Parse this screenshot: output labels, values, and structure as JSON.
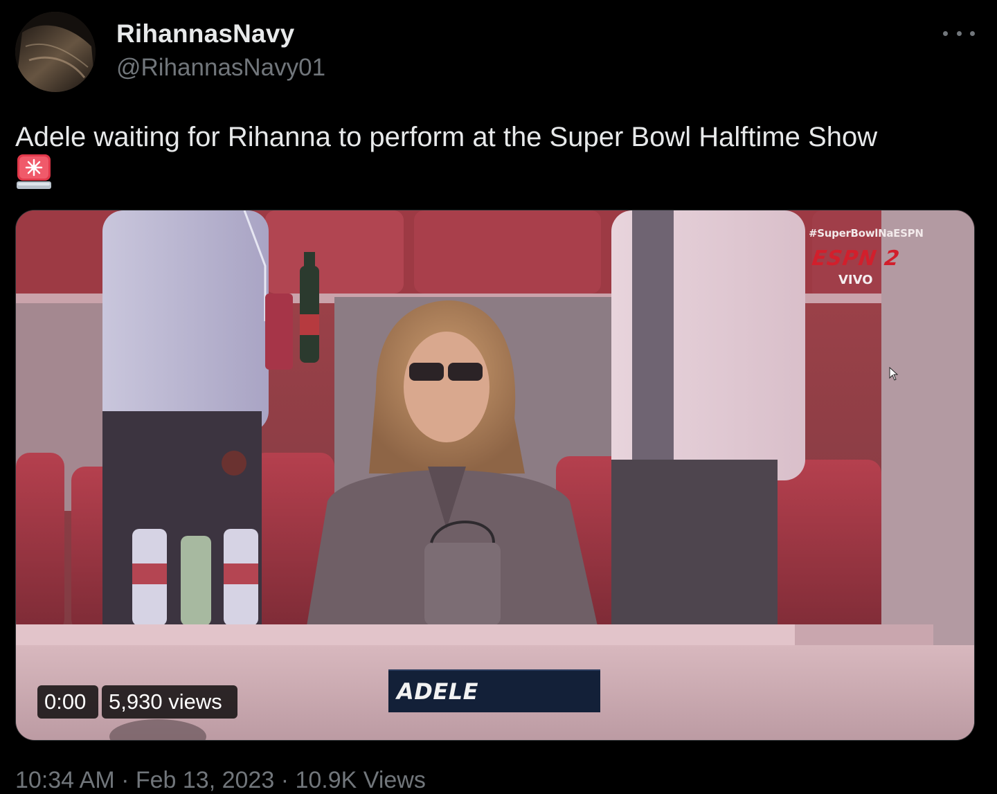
{
  "author": {
    "display_name": "RihannasNavy",
    "handle": "@RihannasNavy01"
  },
  "tweet": {
    "text": "Adele waiting for Rihanna to perform at the Super Bowl Halftime Show",
    "emoji": "🚨"
  },
  "media": {
    "hashtag_overlay": "#SuperBowlNaESPN",
    "network_logo": "ESPN 2",
    "live_label": "VIVO",
    "name_card": "ADELE",
    "timestamp": "0:00",
    "views": "5,930 views"
  },
  "footer": {
    "meta": "10:34 AM · Feb 13, 2023 · 10.9K Views"
  },
  "icons": [
    "more-icon",
    "siren-emoji-icon",
    "cursor-icon"
  ],
  "colors": {
    "background": "#000000",
    "primary_text": "#e7e9ea",
    "secondary_text": "#71767b",
    "name_card_bg": "#132038",
    "espn_red": "#d21f2c"
  }
}
